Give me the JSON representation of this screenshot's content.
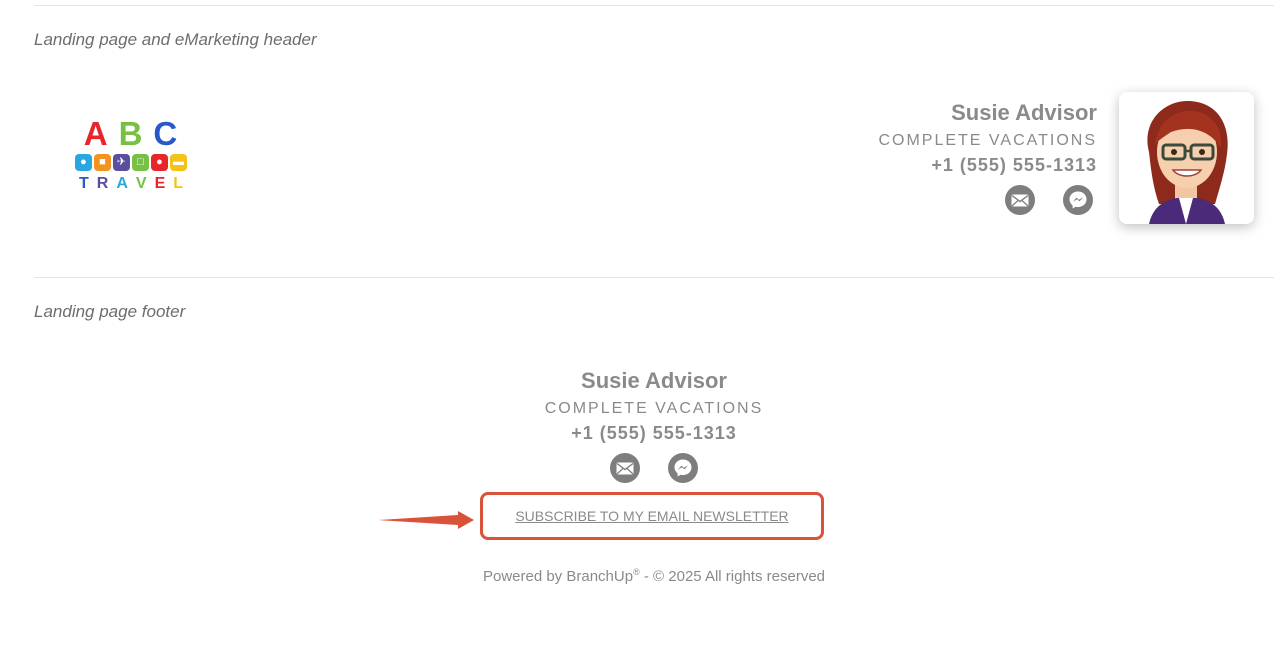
{
  "header_section": {
    "label": "Landing page and eMarketing header",
    "logo": {
      "letters": [
        "A",
        "B",
        "C"
      ],
      "letter_colors": [
        "#e8262a",
        "#76c043",
        "#2a58c9"
      ],
      "icon_colors": [
        "#29a8e0",
        "#f39322",
        "#5a4e9f",
        "#76c043",
        "#e8262a",
        "#f4c319"
      ],
      "word_letters": [
        "T",
        "R",
        "A",
        "V",
        "E",
        "L"
      ],
      "word_colors": [
        "#2a58c9",
        "#5a4e9f",
        "#29a8e0",
        "#76c043",
        "#e8262a",
        "#f4c319"
      ]
    },
    "name": "Susie Advisor",
    "company": "COMPLETE VACATIONS",
    "phone": "+1 (555) 555-1313",
    "icons": [
      "email-icon",
      "messenger-icon"
    ]
  },
  "footer_section": {
    "label": "Landing page footer",
    "name": "Susie Advisor",
    "company": "COMPLETE VACATIONS",
    "phone": "+1 (555) 555-1313",
    "icons": [
      "email-icon",
      "messenger-icon"
    ],
    "subscribe_label": "SUBSCRIBE TO MY EMAIL NEWSLETTER",
    "powered_prefix": "Powered by BranchUp",
    "powered_mark": "®",
    "powered_suffix": " - © 2025 All rights reserved"
  },
  "colors": {
    "highlight": "#d9533a",
    "text_gray": "#8a8a8a",
    "icon_gray": "#7e7e7e"
  }
}
